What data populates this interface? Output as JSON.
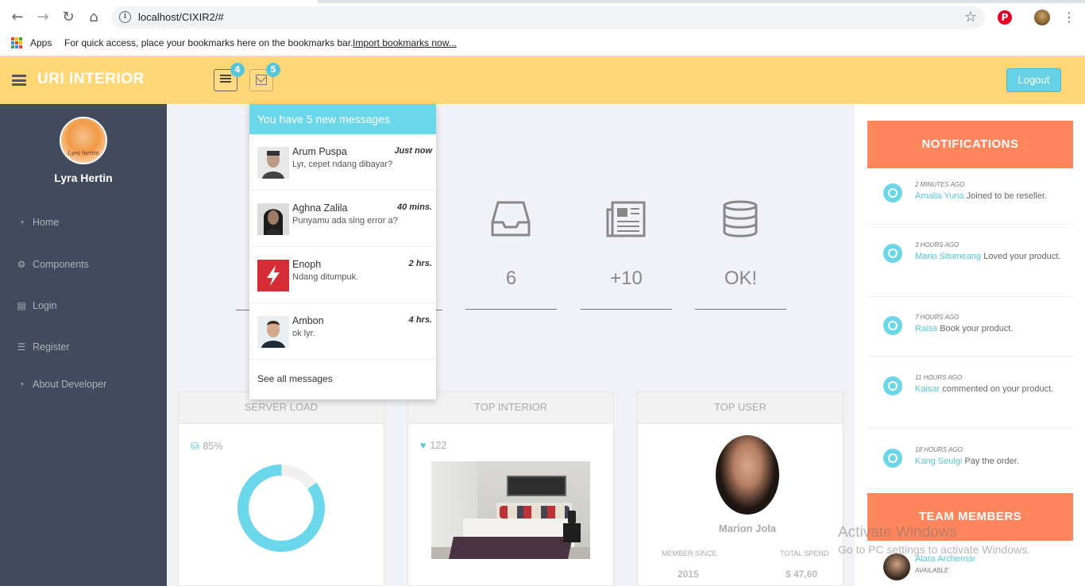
{
  "browser": {
    "url": "localhost/CIXIR2/#",
    "bookmarks_bar": {
      "apps_label": "Apps",
      "hint": "For quick access, place your bookmarks here on the bookmarks bar.",
      "import_link": "Import bookmarks now..."
    }
  },
  "header": {
    "brand": "URI INTERIOR",
    "tasks_badge": "4",
    "mail_badge": "5",
    "logout_label": "Logout"
  },
  "sidebar": {
    "username": "Lyra Hertin",
    "avatar_caption": "Lyra hertin",
    "items": [
      {
        "label": "Home",
        "icon": "dashboard-icon"
      },
      {
        "label": "Components",
        "icon": "cogs-icon"
      },
      {
        "label": "Login",
        "icon": "book-icon"
      },
      {
        "label": "Register",
        "icon": "tasks-icon"
      },
      {
        "label": "About Developer",
        "icon": "dashboard-icon"
      }
    ]
  },
  "stats": [
    {
      "value": "6",
      "icon": "inbox-icon"
    },
    {
      "value": "+10",
      "icon": "newspaper-icon"
    },
    {
      "value": "OK!",
      "icon": "database-icon"
    }
  ],
  "panels": {
    "server_load": {
      "title": "SERVER LOAD",
      "value": "85%",
      "percent": 85
    },
    "top_interior": {
      "title": "TOP INTERIOR",
      "likes": "122"
    },
    "top_user": {
      "title": "TOP USER",
      "name": "Marion Jola",
      "member_since_label": "MEMBER SINCE",
      "member_since": "2015",
      "total_spend_label": "TOTAL SPEND",
      "total_spend": "$ 47,60"
    }
  },
  "messages_dropdown": {
    "header": "You have 5 new messages",
    "messages": [
      {
        "from": "Arum Puspa",
        "time": "Just now",
        "body": "Lyr, cepet ndang dibayar?"
      },
      {
        "from": "Aghna Zalila",
        "time": "40 mins.",
        "body": "Punyamu ada sing error a?"
      },
      {
        "from": "Enoph",
        "time": "2 hrs.",
        "body": "Ndang ditumpuk."
      },
      {
        "from": "Ambon",
        "time": "4 hrs.",
        "body": "ok lyr."
      }
    ],
    "see_all": "See all messages"
  },
  "notifications": {
    "title": "NOTIFICATIONS",
    "items": [
      {
        "time": "2 MINUTES AGO",
        "who": "Amalia Yuna",
        "text": "Joined to be reseller."
      },
      {
        "time": "3 HOURS AGO",
        "who": "Mario Situmeang",
        "text": "Loved your product."
      },
      {
        "time": "7 HOURS AGO",
        "who": "Raisa",
        "text": "Book your product."
      },
      {
        "time": "11 HOURS AGO",
        "who": "Kaisar",
        "text": "commented on your product."
      },
      {
        "time": "18 HOURS AGO",
        "who": "Kang Seulgi",
        "text": "Pay the order."
      }
    ]
  },
  "team": {
    "title": "TEAM MEMBERS",
    "member_name": "Alara Archernar",
    "member_status": "AVAILABLE"
  },
  "watermark": {
    "line1": "Activate Windows",
    "line2": "Go to PC settings to activate Windows."
  },
  "colors": {
    "topbar": "#ffd777",
    "sidebar": "#424a5d",
    "accent": "#6ad8ea",
    "notif_header": "#ff865c"
  }
}
